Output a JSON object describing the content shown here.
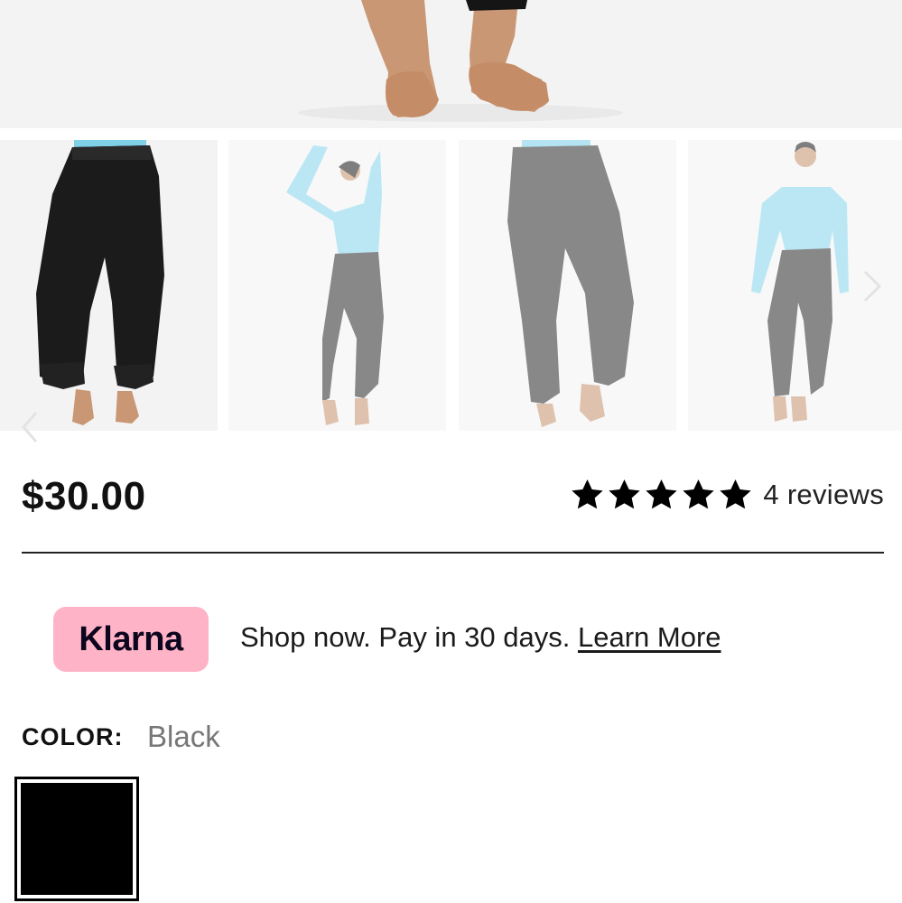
{
  "gallery": {
    "thumbnails": [
      "thumbnail-front-black",
      "thumbnail-side-pose",
      "thumbnail-back-view",
      "thumbnail-full-front"
    ],
    "nav_icons": [
      "chevron-left-icon",
      "chevron-right-icon"
    ]
  },
  "product": {
    "price": "$30.00",
    "rating": 5,
    "reviews_label": "4 reviews"
  },
  "klarna": {
    "badge": "Klarna",
    "message": "Shop now. Pay in 30 days.",
    "link": "Learn More",
    "badge_color": "#ffb3c7"
  },
  "color": {
    "label": "COLOR:",
    "selected": "Black",
    "swatches": [
      {
        "name": "Black",
        "hex": "#000000",
        "selected": true
      }
    ]
  }
}
